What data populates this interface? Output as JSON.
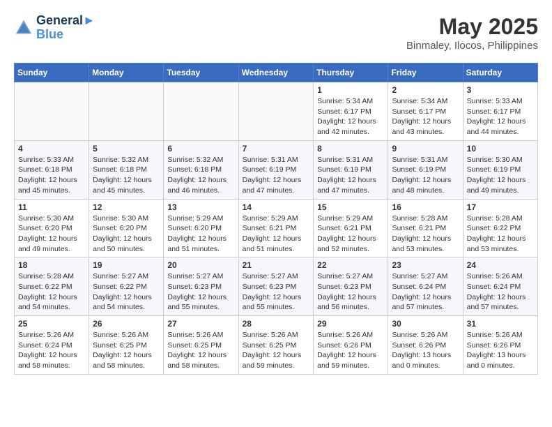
{
  "header": {
    "logo_line1": "General",
    "logo_line2": "Blue",
    "month_year": "May 2025",
    "location": "Binmaley, Ilocos, Philippines"
  },
  "days_of_week": [
    "Sunday",
    "Monday",
    "Tuesday",
    "Wednesday",
    "Thursday",
    "Friday",
    "Saturday"
  ],
  "weeks": [
    [
      {
        "day": "",
        "empty": true
      },
      {
        "day": "",
        "empty": true
      },
      {
        "day": "",
        "empty": true
      },
      {
        "day": "",
        "empty": true
      },
      {
        "day": "1",
        "sunrise": "5:34 AM",
        "sunset": "6:17 PM",
        "daylight": "12 hours and 42 minutes."
      },
      {
        "day": "2",
        "sunrise": "5:34 AM",
        "sunset": "6:17 PM",
        "daylight": "12 hours and 43 minutes."
      },
      {
        "day": "3",
        "sunrise": "5:33 AM",
        "sunset": "6:17 PM",
        "daylight": "12 hours and 44 minutes."
      }
    ],
    [
      {
        "day": "4",
        "sunrise": "5:33 AM",
        "sunset": "6:18 PM",
        "daylight": "12 hours and 45 minutes."
      },
      {
        "day": "5",
        "sunrise": "5:32 AM",
        "sunset": "6:18 PM",
        "daylight": "12 hours and 45 minutes."
      },
      {
        "day": "6",
        "sunrise": "5:32 AM",
        "sunset": "6:18 PM",
        "daylight": "12 hours and 46 minutes."
      },
      {
        "day": "7",
        "sunrise": "5:31 AM",
        "sunset": "6:19 PM",
        "daylight": "12 hours and 47 minutes."
      },
      {
        "day": "8",
        "sunrise": "5:31 AM",
        "sunset": "6:19 PM",
        "daylight": "12 hours and 47 minutes."
      },
      {
        "day": "9",
        "sunrise": "5:31 AM",
        "sunset": "6:19 PM",
        "daylight": "12 hours and 48 minutes."
      },
      {
        "day": "10",
        "sunrise": "5:30 AM",
        "sunset": "6:19 PM",
        "daylight": "12 hours and 49 minutes."
      }
    ],
    [
      {
        "day": "11",
        "sunrise": "5:30 AM",
        "sunset": "6:20 PM",
        "daylight": "12 hours and 49 minutes."
      },
      {
        "day": "12",
        "sunrise": "5:30 AM",
        "sunset": "6:20 PM",
        "daylight": "12 hours and 50 minutes."
      },
      {
        "day": "13",
        "sunrise": "5:29 AM",
        "sunset": "6:20 PM",
        "daylight": "12 hours and 51 minutes."
      },
      {
        "day": "14",
        "sunrise": "5:29 AM",
        "sunset": "6:21 PM",
        "daylight": "12 hours and 51 minutes."
      },
      {
        "day": "15",
        "sunrise": "5:29 AM",
        "sunset": "6:21 PM",
        "daylight": "12 hours and 52 minutes."
      },
      {
        "day": "16",
        "sunrise": "5:28 AM",
        "sunset": "6:21 PM",
        "daylight": "12 hours and 53 minutes."
      },
      {
        "day": "17",
        "sunrise": "5:28 AM",
        "sunset": "6:22 PM",
        "daylight": "12 hours and 53 minutes."
      }
    ],
    [
      {
        "day": "18",
        "sunrise": "5:28 AM",
        "sunset": "6:22 PM",
        "daylight": "12 hours and 54 minutes."
      },
      {
        "day": "19",
        "sunrise": "5:27 AM",
        "sunset": "6:22 PM",
        "daylight": "12 hours and 54 minutes."
      },
      {
        "day": "20",
        "sunrise": "5:27 AM",
        "sunset": "6:23 PM",
        "daylight": "12 hours and 55 minutes."
      },
      {
        "day": "21",
        "sunrise": "5:27 AM",
        "sunset": "6:23 PM",
        "daylight": "12 hours and 55 minutes."
      },
      {
        "day": "22",
        "sunrise": "5:27 AM",
        "sunset": "6:23 PM",
        "daylight": "12 hours and 56 minutes."
      },
      {
        "day": "23",
        "sunrise": "5:27 AM",
        "sunset": "6:24 PM",
        "daylight": "12 hours and 57 minutes."
      },
      {
        "day": "24",
        "sunrise": "5:26 AM",
        "sunset": "6:24 PM",
        "daylight": "12 hours and 57 minutes."
      }
    ],
    [
      {
        "day": "25",
        "sunrise": "5:26 AM",
        "sunset": "6:24 PM",
        "daylight": "12 hours and 58 minutes."
      },
      {
        "day": "26",
        "sunrise": "5:26 AM",
        "sunset": "6:25 PM",
        "daylight": "12 hours and 58 minutes."
      },
      {
        "day": "27",
        "sunrise": "5:26 AM",
        "sunset": "6:25 PM",
        "daylight": "12 hours and 58 minutes."
      },
      {
        "day": "28",
        "sunrise": "5:26 AM",
        "sunset": "6:25 PM",
        "daylight": "12 hours and 59 minutes."
      },
      {
        "day": "29",
        "sunrise": "5:26 AM",
        "sunset": "6:26 PM",
        "daylight": "12 hours and 59 minutes."
      },
      {
        "day": "30",
        "sunrise": "5:26 AM",
        "sunset": "6:26 PM",
        "daylight": "13 hours and 0 minutes."
      },
      {
        "day": "31",
        "sunrise": "5:26 AM",
        "sunset": "6:26 PM",
        "daylight": "13 hours and 0 minutes."
      }
    ]
  ]
}
